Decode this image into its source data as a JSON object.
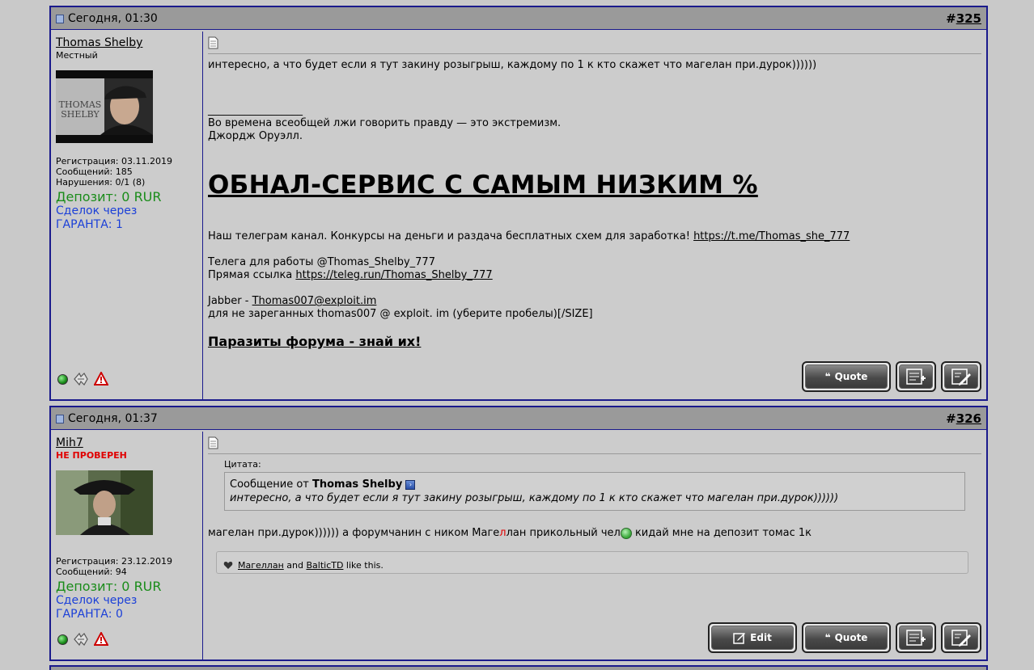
{
  "posts": [
    {
      "date": "Сегодня, 01:30",
      "number_prefix": "#",
      "number": "325",
      "user": {
        "name": "Thomas Shelby",
        "title": "Местный",
        "avatar_text_1": "THOMAS",
        "avatar_text_2": "SHELBY",
        "reg": "Регистрация: 03.11.2019",
        "messages": "Сообщений: 185",
        "violations": "Нарушения: 0/1 (8)",
        "deposit": "Депозит: 0 RUR",
        "deals_1": "Сделок через",
        "deals_2": "ГАРАНТА: 1"
      },
      "message": "интересно, а что будет если я тут закину розыгрыш, каждому по 1 к кто скажет что магелан при.дурок))))))",
      "sig_separator": "__________________",
      "sig_quote_1": "Во времена всеобщей лжи говорить правду — это экстремизм.",
      "sig_quote_2": "Джордж Оруэлл.",
      "big_title": "ОБНАЛ-СЕРВИС С САМЫМ НИЗКИМ %",
      "tg_text": "Наш телеграм канал. Конкурсы на деньги и раздача бесплатных схем для заработка! ",
      "tg_link": "https://t.me/Thomas_she_777",
      "work_tg": "Телега для работы @Thomas_Shelby_777",
      "direct_text": "Прямая ссылка ",
      "direct_link": "https://teleg.run/Thomas_Shelby_777",
      "jabber_text": "Jabber - ",
      "jabber_link": "Thomas007@exploit.im",
      "jabber_note": "для не зареганных thomas007 @ exploit. im (уберите пробелы)[/SIZE]",
      "parasites": "Паразиты форума - знай их!",
      "quote_btn": "Quote"
    },
    {
      "date": "Сегодня, 01:37",
      "number_prefix": "#",
      "number": "326",
      "user": {
        "name": "Mih7",
        "title": "НЕ ПРОВЕРЕН",
        "reg": "Регистрация: 23.12.2019",
        "messages": "Сообщений: 94",
        "deposit": "Депозит: 0 RUR",
        "deals_1": "Сделок через",
        "deals_2": "ГАРАНТА: 0"
      },
      "quote_label": "Цитата:",
      "quote_from": "Сообщение от ",
      "quote_author": "Thomas Shelby",
      "quote_text": "интересно, а что будет если я тут закину розыгрыш, каждому по 1 к кто скажет что магелан при.дурок))))))",
      "message_a": "магелан при.дурок)))))) а форумчанин с ником Маге",
      "message_red": "л",
      "message_b": "лан прикольный чел",
      "message_c": " кидай мне на депозит томас 1к",
      "like_user_1": "Магеллан",
      "like_and": " and ",
      "like_user_2": "BalticTD",
      "like_suffix": " like this.",
      "edit_btn": "Edit",
      "quote_btn": "Quote"
    }
  ]
}
